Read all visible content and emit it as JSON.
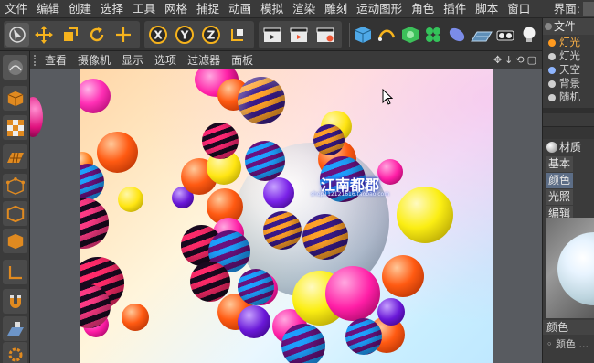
{
  "menubar": {
    "items": [
      "文件",
      "编辑",
      "创建",
      "选择",
      "工具",
      "网格",
      "捕捉",
      "动画",
      "模拟",
      "渲染",
      "雕刻",
      "运动图形",
      "角色",
      "插件",
      "脚本",
      "窗口"
    ],
    "layout_label": "界面:"
  },
  "toolbar": {
    "axis_x": "X",
    "axis_y": "Y",
    "axis_z": "Z"
  },
  "viewport": {
    "menu": [
      "查看",
      "摄像机",
      "显示",
      "选项",
      "过滤器",
      "面板"
    ],
    "nav_icons": [
      "✥",
      "↓",
      "⟲",
      "▢"
    ]
  },
  "watermark": {
    "title": "江南都郡",
    "url": "shop112121616.taobao.com"
  },
  "right_panel": {
    "objects_tab": "文件",
    "objects": [
      {
        "label": "灯光",
        "color": "#ff8c1a",
        "text_color": "#ffb347"
      },
      {
        "label": "灯光",
        "color": "#cfcfcf",
        "text_color": "#dcdcdc"
      },
      {
        "label": "天空",
        "color": "#8fb6ff",
        "text_color": "#dcdcdc"
      },
      {
        "label": "背景",
        "color": "#cfcfcf",
        "text_color": "#dcdcdc"
      },
      {
        "label": "随机",
        "color": "#cfcfcf",
        "text_color": "#dcdcdc"
      }
    ],
    "material_label": "材质",
    "attr_tabs_row1": [
      "基本",
      "颜色"
    ],
    "attr_tabs_row2": [
      "光照",
      "编辑"
    ],
    "color_section": "颜色",
    "color_field": "◦ 颜色 ..."
  },
  "colors": {
    "accent": "#5c6d86",
    "panel": "#3b3b3b"
  }
}
